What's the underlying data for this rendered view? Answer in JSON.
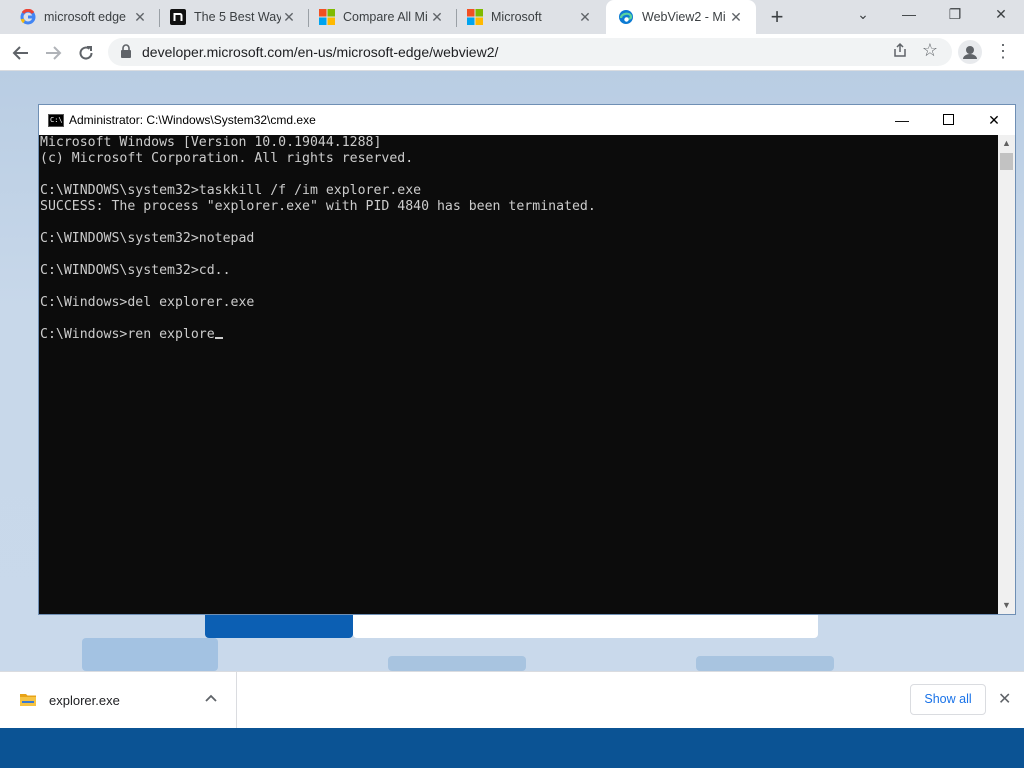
{
  "browser": {
    "tabs": [
      {
        "title": "microsoft edge",
        "icon": "google-icon"
      },
      {
        "title": "The 5 Best Way",
        "icon": "n-logo-icon"
      },
      {
        "title": "Compare All Mi",
        "icon": "microsoft-logo-icon"
      },
      {
        "title": "Microsoft",
        "icon": "microsoft-logo-icon"
      },
      {
        "title": "WebView2 - Mi",
        "icon": "edge-icon",
        "active": true
      }
    ],
    "url": "developer.microsoft.com/en-us/microsoft-edge/webview2/"
  },
  "cmd": {
    "title": "Administrator: C:\\Windows\\System32\\cmd.exe",
    "icon_text": "C:\\",
    "lines": [
      "Microsoft Windows [Version 10.0.19044.1288]",
      "(c) Microsoft Corporation. All rights reserved.",
      "",
      "C:\\WINDOWS\\system32>taskkill /f /im explorer.exe",
      "SUCCESS: The process \"explorer.exe\" with PID 4840 has been terminated.",
      "",
      "C:\\WINDOWS\\system32>notepad",
      "",
      "C:\\WINDOWS\\system32>cd..",
      "",
      "C:\\Windows>del explorer.exe",
      "",
      "C:\\Windows>ren explore"
    ]
  },
  "downloads": {
    "file_name": "explorer.exe",
    "show_all_label": "Show all"
  },
  "colors": {
    "console_bg": "#0c0c0c",
    "console_text": "#cccccc",
    "taskbar": "#0b5394",
    "link_blue": "#1a73e8"
  }
}
